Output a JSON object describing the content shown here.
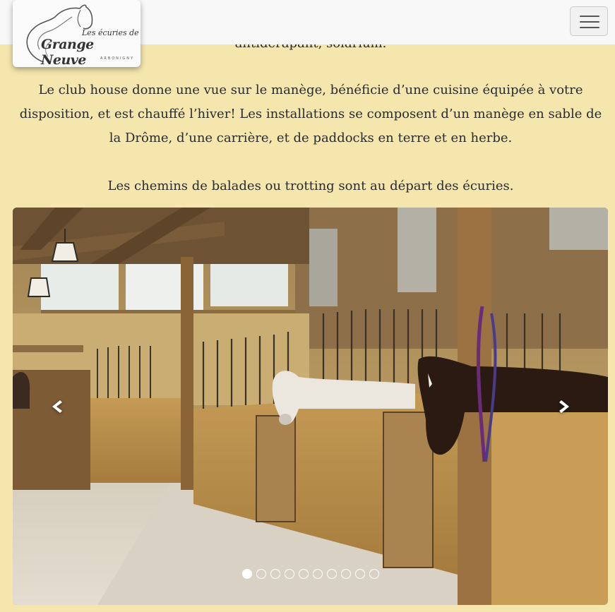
{
  "header": {
    "logo": {
      "line1": "Les écuries de",
      "line2": "Grange Neuve",
      "line3": "ARBONIGNY"
    },
    "menu_icon": "hamburger-icon"
  },
  "content": {
    "partial_line": "antidérapant, solarium.",
    "paragraph1": [
      "Le club house donne une vue sur le manège, bénéficie d’une cuisine équipée à votre",
      "disposition, et est chauffé l’hiver! Les installations se composent d’un manège en sable de",
      "la Drôme, d’une carrière, et de paddocks en terre et en herbe."
    ],
    "paragraph2": "Les chemins de balades ou trotting sont au départ des écuries."
  },
  "carousel": {
    "image": "stable-interior-with-horses",
    "prev_icon": "chevron-left-icon",
    "next_icon": "chevron-right-icon",
    "slide_count": 10,
    "active_index": 0
  },
  "colors": {
    "page_background": "#f5e6ad",
    "navbar_background": "#f8f8f8",
    "text": "#2b2b2b"
  }
}
